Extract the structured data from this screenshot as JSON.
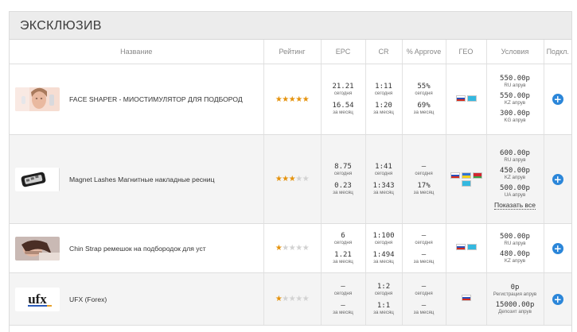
{
  "section_title": "ЭКСКЛЮЗИВ",
  "columns": {
    "name": "Название",
    "rating": "Рейтинг",
    "epc": "EPC",
    "cr": "CR",
    "approve": "% Approve",
    "geo": "ГЕО",
    "conditions": "Условия",
    "connect": "Подкл."
  },
  "offers": [
    {
      "name": "FACE SHAPER - МИОСТИМУЛЯТОР ДЛЯ ПОДБОРОД",
      "thumb_icon": "face-photo",
      "rating": 5,
      "epc": [
        {
          "v": "21.21",
          "s": "сегодня"
        },
        {
          "v": "16.54",
          "s": "за месяц"
        }
      ],
      "cr": [
        {
          "v": "1:11",
          "s": "сегодня"
        },
        {
          "v": "1:20",
          "s": "за месяц"
        }
      ],
      "approve": [
        {
          "v": "55%",
          "s": "сегодня"
        },
        {
          "v": "69%",
          "s": "за месяц"
        }
      ],
      "geo": [
        "ru",
        "kz"
      ],
      "conditions": [
        {
          "v": "550.00р",
          "l": "RU апрув"
        },
        {
          "v": "550.00р",
          "l": "KZ апрув"
        },
        {
          "v": "300.00р",
          "l": "KG апрув"
        }
      ],
      "show_all": ""
    },
    {
      "name": "Magnet Lashes Магнитные накладные ресниц",
      "thumb_icon": "lashes-box",
      "rating": 3,
      "epc": [
        {
          "v": "8.75",
          "s": "сегодня"
        },
        {
          "v": "0.23",
          "s": "за месяц"
        }
      ],
      "cr": [
        {
          "v": "1:41",
          "s": "сегодня"
        },
        {
          "v": "1:343",
          "s": "за месяц"
        }
      ],
      "approve": [
        {
          "v": "—",
          "s": "сегодня"
        },
        {
          "v": "17%",
          "s": "за месяц"
        }
      ],
      "geo": [
        "ru",
        "ua",
        "by",
        "kz"
      ],
      "conditions": [
        {
          "v": "600.00р",
          "l": "RU апрув"
        },
        {
          "v": "450.00р",
          "l": "KZ апрув"
        },
        {
          "v": "500.00р",
          "l": "UA апрув"
        }
      ],
      "show_all": "Показать все"
    },
    {
      "name": "Chin Strap ремешок на подбородок для уст",
      "thumb_icon": "sleeping-woman",
      "rating": 1,
      "epc": [
        {
          "v": "6",
          "s": "сегодня"
        },
        {
          "v": "1.21",
          "s": "за месяц"
        }
      ],
      "cr": [
        {
          "v": "1:100",
          "s": "сегодня"
        },
        {
          "v": "1:494",
          "s": "за месяц"
        }
      ],
      "approve": [
        {
          "v": "—",
          "s": "сегодня"
        },
        {
          "v": "—",
          "s": "за месяц"
        }
      ],
      "geo": [
        "ru",
        "kz"
      ],
      "conditions": [
        {
          "v": "500.00р",
          "l": "RU апрув"
        },
        {
          "v": "480.00р",
          "l": "KZ апрув"
        }
      ],
      "show_all": ""
    },
    {
      "name": "UFX (Forex)",
      "thumb_icon": "ufx-logo",
      "logo_text": "ufx",
      "rating": 1,
      "epc": [
        {
          "v": "—",
          "s": "сегодня"
        },
        {
          "v": "—",
          "s": "за месяц"
        }
      ],
      "cr": [
        {
          "v": "1:2",
          "s": "сегодня"
        },
        {
          "v": "1:1",
          "s": "за месяц"
        }
      ],
      "approve": [
        {
          "v": "—",
          "s": "сегодня"
        },
        {
          "v": "—",
          "s": "за месяц"
        }
      ],
      "geo": [
        "ru"
      ],
      "conditions": [
        {
          "v": "0р",
          "l": "Регистрация апрув"
        },
        {
          "v": "15000.00р",
          "l": "Депозит апрув"
        }
      ],
      "show_all": ""
    }
  ],
  "colors": {
    "star_on": "#e5930e",
    "star_off": "#d2d2d2",
    "connect_button": "#2b86d9"
  },
  "icons": {
    "rating": "star-icon",
    "connect": "plus-circle-icon"
  }
}
